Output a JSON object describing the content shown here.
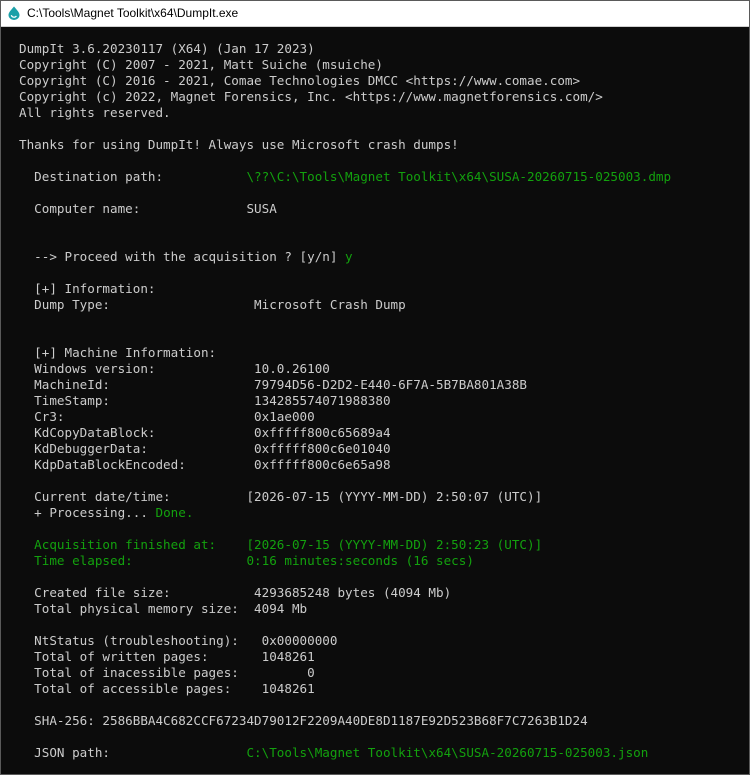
{
  "window": {
    "title": "C:\\Tools\\Magnet Toolkit\\x64\\DumpIt.exe"
  },
  "console": {
    "lines": [
      [
        {
          "t": "DumpIt 3.6.20230117 (X64) (Jan 17 2023)"
        }
      ],
      [
        {
          "t": "Copyright (C) 2007 - 2021, Matt Suiche (msuiche)"
        }
      ],
      [
        {
          "t": "Copyright (C) 2016 - 2021, Comae Technologies DMCC <https://www.comae.com>"
        }
      ],
      [
        {
          "t": "Copyright (c) 2022, Magnet Forensics, Inc. <https://www.magnetforensics.com/>"
        }
      ],
      [
        {
          "t": "All rights reserved."
        }
      ],
      [],
      [
        {
          "t": "Thanks for using DumpIt! Always use Microsoft crash dumps!"
        }
      ],
      [],
      [
        {
          "t": "  Destination path:           "
        },
        {
          "t": "\\??\\C:\\Tools\\Magnet Toolkit\\x64\\SUSA-20260715-025003.dmp",
          "c": "g"
        }
      ],
      [],
      [
        {
          "t": "  Computer name:              SUSA"
        }
      ],
      [],
      [],
      [
        {
          "t": "  --> Proceed with the acquisition ? [y/n] "
        },
        {
          "t": "y",
          "c": "g"
        }
      ],
      [],
      [
        {
          "t": "  [+] Information:"
        }
      ],
      [
        {
          "t": "  Dump Type:                   Microsoft Crash Dump"
        }
      ],
      [],
      [],
      [
        {
          "t": "  [+] Machine Information:"
        }
      ],
      [
        {
          "t": "  Windows version:             10.0.26100"
        }
      ],
      [
        {
          "t": "  MachineId:                   79794D56-D2D2-E440-6F7A-5B7BA801A38B"
        }
      ],
      [
        {
          "t": "  TimeStamp:                   134285574071988380"
        }
      ],
      [
        {
          "t": "  Cr3:                         0x1ae000"
        }
      ],
      [
        {
          "t": "  KdCopyDataBlock:             0xfffff800c65689a4"
        }
      ],
      [
        {
          "t": "  KdDebuggerData:              0xfffff800c6e01040"
        }
      ],
      [
        {
          "t": "  KdpDataBlockEncoded:         0xfffff800c6e65a98"
        }
      ],
      [],
      [
        {
          "t": "  Current date/time:          [2026-07-15 (YYYY-MM-DD) 2:50:07 (UTC)]"
        }
      ],
      [
        {
          "t": "  + Processing... "
        },
        {
          "t": "Done.",
          "c": "g"
        }
      ],
      [],
      [
        {
          "t": "  Acquisition finished at:    [2026-07-15 (YYYY-MM-DD) 2:50:23 (UTC)]",
          "c": "g"
        }
      ],
      [
        {
          "t": "  Time elapsed:               0:16 minutes:seconds (16 secs)",
          "c": "g"
        }
      ],
      [],
      [
        {
          "t": "  Created file size:           4293685248 bytes (4094 Mb)"
        }
      ],
      [
        {
          "t": "  Total physical memory size:  4094 Mb"
        }
      ],
      [],
      [
        {
          "t": "  NtStatus (troubleshooting):   0x00000000"
        }
      ],
      [
        {
          "t": "  Total of written pages:       1048261"
        }
      ],
      [
        {
          "t": "  Total of inacessible pages:         0"
        }
      ],
      [
        {
          "t": "  Total of accessible pages:    1048261"
        }
      ],
      [],
      [
        {
          "t": "  SHA-256: 2586BBA4C682CCF67234D79012F2209A40DE8D1187E92D523B68F7C7263B1D24"
        }
      ],
      [],
      [
        {
          "t": "  JSON path:                  "
        },
        {
          "t": "C:\\Tools\\Magnet Toolkit\\x64\\SUSA-20260715-025003.json",
          "c": "g"
        }
      ]
    ]
  }
}
